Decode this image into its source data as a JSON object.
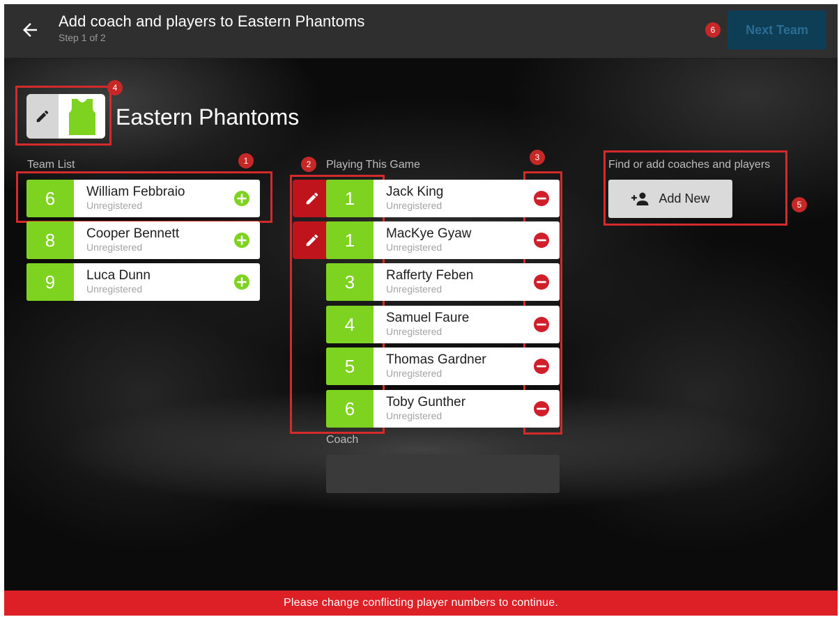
{
  "header": {
    "title": "Add coach and players to Eastern Phantoms",
    "subtitle": "Step 1 of 2",
    "next_button": "Next Team"
  },
  "team": {
    "name": "Eastern Phantoms",
    "shirt_color": "#7ed321"
  },
  "annotations": [
    "1",
    "2",
    "3",
    "4",
    "5",
    "6"
  ],
  "team_list": {
    "label": "Team List",
    "players": [
      {
        "number": "6",
        "name": "William Febbraio",
        "status": "Unregistered"
      },
      {
        "number": "8",
        "name": "Cooper Bennett",
        "status": "Unregistered"
      },
      {
        "number": "9",
        "name": "Luca Dunn",
        "status": "Unregistered"
      }
    ]
  },
  "playing": {
    "label": "Playing This Game",
    "players": [
      {
        "number": "1",
        "name": "Jack King",
        "status": "Unregistered"
      },
      {
        "number": "1",
        "name": "MacKye Gyaw",
        "status": "Unregistered"
      },
      {
        "number": "3",
        "name": "Rafferty Feben",
        "status": "Unregistered"
      },
      {
        "number": "4",
        "name": "Samuel Faure",
        "status": "Unregistered"
      },
      {
        "number": "5",
        "name": "Thomas Gardner",
        "status": "Unregistered"
      },
      {
        "number": "6",
        "name": "Toby Gunther",
        "status": "Unregistered"
      }
    ]
  },
  "coach": {
    "label": "Coach"
  },
  "find": {
    "label": "Find or add coaches and players",
    "add_button": "Add New"
  },
  "banner": {
    "text": "Please change conflicting player numbers to continue."
  },
  "colors": {
    "number_green": "#7ed321",
    "remove_red": "#d01f2b",
    "edit_red": "#c0141d",
    "banner_red": "#dd1f26",
    "annotation_red": "#d42a2a",
    "next_button_bg": "#0e3d56"
  },
  "icons": {
    "back": "arrow-left-icon",
    "edit": "pencil-icon",
    "shirt": "jersey-icon",
    "add": "plus-circle-icon",
    "remove": "minus-circle-icon",
    "add_person": "person-add-icon"
  }
}
